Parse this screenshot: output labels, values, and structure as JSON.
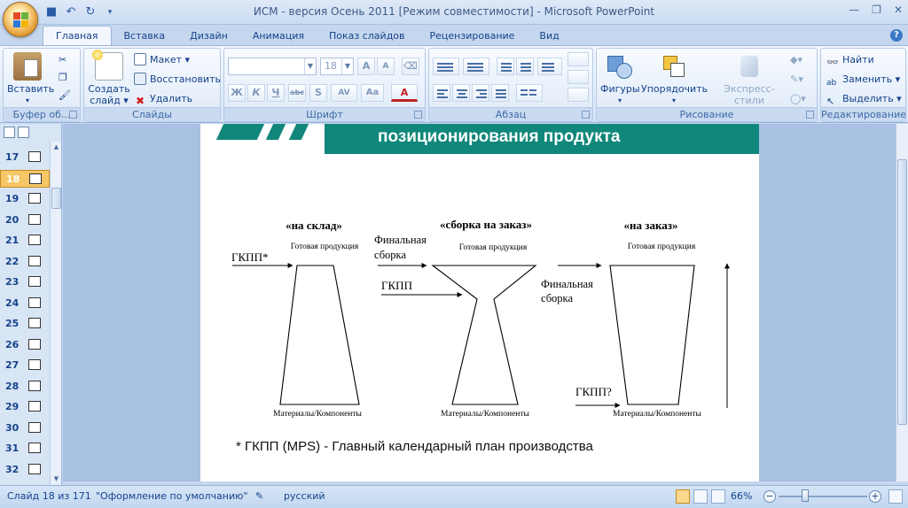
{
  "window": {
    "title": "ИСМ - версия Осень 2011 [Режим совместимости] - Microsoft PowerPoint"
  },
  "tabs": [
    {
      "label": "Главная",
      "active": true
    },
    {
      "label": "Вставка"
    },
    {
      "label": "Дизайн"
    },
    {
      "label": "Анимация"
    },
    {
      "label": "Показ слайдов"
    },
    {
      "label": "Рецензирование"
    },
    {
      "label": "Вид"
    }
  ],
  "ribbon": {
    "clipboard": {
      "label": "Буфер об...",
      "paste": "Вставить"
    },
    "slides": {
      "label": "Слайды",
      "new_slide_1": "Создать",
      "new_slide_2": "слайд ▾",
      "layout": "Макет ▾",
      "reset": "Восстановить",
      "delete": "Удалить"
    },
    "font": {
      "label": "Шрифт",
      "size": "18"
    },
    "paragraph": {
      "label": "Абзац"
    },
    "drawing": {
      "label": "Рисование",
      "shapes": "Фигуры",
      "arrange": "Упорядочить",
      "quick_styles": "Экспресс-стили"
    },
    "editing": {
      "label": "Редактирование",
      "find": "Найти",
      "replace": "Заменить ▾",
      "select": "Выделить ▾"
    }
  },
  "slide_panel": {
    "slides": [
      "17",
      "18",
      "19",
      "20",
      "21",
      "22",
      "23",
      "24",
      "25",
      "26",
      "27",
      "28",
      "29",
      "30",
      "31",
      "32"
    ],
    "selected": "18"
  },
  "slide": {
    "title": "позиционирования продукта",
    "headers": {
      "stock": "«на склад»",
      "assemble": "«сборка на заказ»",
      "order": "«на заказ»"
    },
    "finished_goods": "Готовая продукция",
    "materials": "Материалы/Компоненты",
    "final_assembly_1": "Финальная",
    "final_assembly_2": "сборка",
    "mps_star": "ГКПП*",
    "mps": "ГКПП",
    "mps_q": "ГКПП?",
    "footnote": "* ГКПП (MPS) - Главный календарный план производства"
  },
  "statusbar": {
    "slide_count": "Слайд 18 из 171",
    "theme": "\"Оформление по умолчанию\"",
    "language": "русский",
    "zoom": "66%"
  }
}
